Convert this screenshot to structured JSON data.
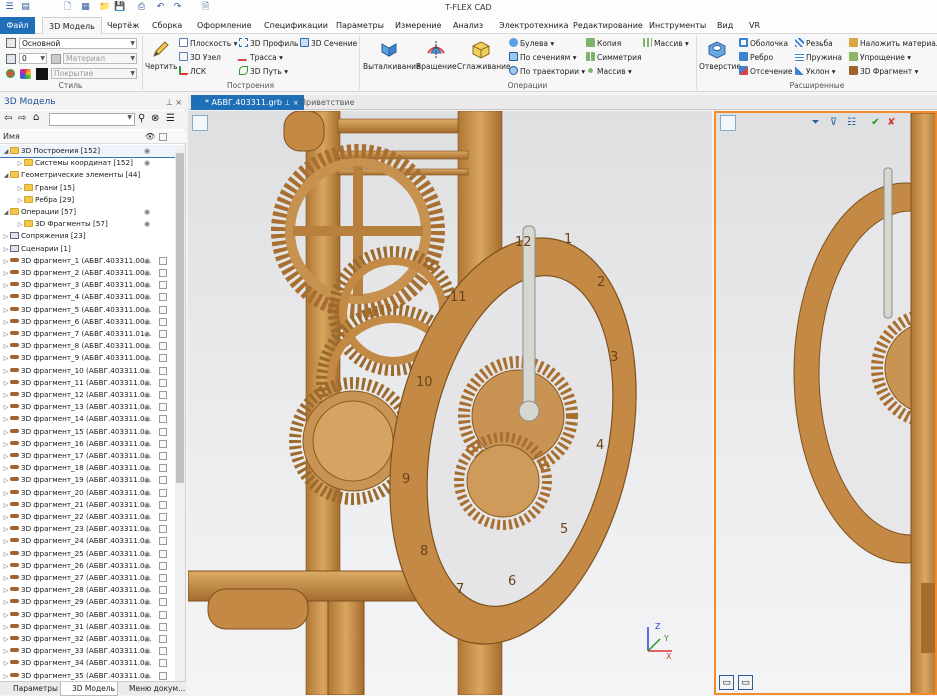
{
  "app": {
    "title": "T-FLEX CAD"
  },
  "menu": {
    "file": "Файл",
    "tabs": [
      "3D Модель",
      "Чертёж",
      "Сборка",
      "Оформление",
      "Спецификации",
      "Параметры",
      "Измерение",
      "Анализ",
      "Электротехника",
      "Редактирование",
      "Инструменты",
      "Вид",
      "VR"
    ],
    "active_index": 0
  },
  "ribbon": {
    "style": {
      "label": "Стиль",
      "layer_value": "Основной",
      "level_value": "0",
      "material_placeholder": "Материал",
      "coating_placeholder": "Покрытие"
    },
    "construct": {
      "label": "Построения",
      "draw": "Чертить",
      "plane": "Плоскость",
      "node3d": "3D Узел",
      "lcs": "ЛСК",
      "profile3d": "3D Профиль",
      "route": "Трасса",
      "path3d": "3D Путь",
      "section3d": "3D Сечение"
    },
    "operations": {
      "label": "Операции",
      "extrude": "Выталкивание",
      "rotate": "Вращение",
      "smooth": "Сглаживание",
      "boolean": "Булева",
      "by_sections": "По сечениям",
      "by_path": "По траектории",
      "copy": "Копия",
      "symmetry": "Симметрия",
      "array": "Массив",
      "array2": "Массив"
    },
    "extended": {
      "label": "Расширенные",
      "hole": "Отверстие",
      "shell": "Оболочка",
      "rib": "Ребро",
      "cutoff": "Отсечение",
      "thread": "Резьба",
      "spring": "Пружина",
      "slope": "Уклон",
      "apply_material": "Наложить материал",
      "simplify": "Упрощение",
      "fragment3d": "3D Фрагмент"
    }
  },
  "panel": {
    "title": "3D Модель",
    "column_name": "Имя",
    "tree": [
      {
        "label": "3D Построения [152]",
        "level": 0,
        "kind": "folder",
        "exp": "open",
        "eye": true,
        "selected": true
      },
      {
        "label": "Системы координат [152]",
        "level": 1,
        "kind": "folder",
        "exp": "closed",
        "eye": true
      },
      {
        "label": "Геометрические элементы [44]",
        "level": 0,
        "kind": "folder",
        "exp": "open"
      },
      {
        "label": "Грани [15]",
        "level": 1,
        "kind": "folder",
        "exp": "closed"
      },
      {
        "label": "Ребра [29]",
        "level": 1,
        "kind": "folder",
        "exp": "closed"
      },
      {
        "label": "Операции [57]",
        "level": 0,
        "kind": "folder",
        "exp": "open",
        "eye": true
      },
      {
        "label": "3D Фрагменты [57]",
        "level": 1,
        "kind": "folder",
        "exp": "closed",
        "eye": true
      },
      {
        "label": "Сопряжения [23]",
        "level": 0,
        "kind": "node",
        "exp": "closed"
      },
      {
        "label": "Сценарии [1]",
        "level": 0,
        "kind": "node",
        "exp": "closed"
      },
      {
        "label": "3D фрагмент_1 (АБВГ.403311.00...",
        "level": 0,
        "kind": "frag",
        "exp": "closed",
        "eye": true,
        "copy": true
      },
      {
        "label": "3D фрагмент_2 (АБВГ.403311.00...",
        "level": 0,
        "kind": "frag",
        "exp": "closed",
        "eye": true,
        "copy": true
      },
      {
        "label": "3D фрагмент_3 (АБВГ.403311.00...",
        "level": 0,
        "kind": "frag",
        "exp": "closed",
        "eye": true,
        "copy": true
      },
      {
        "label": "3D фрагмент_4 (АБВГ.403311.00...",
        "level": 0,
        "kind": "frag",
        "exp": "closed",
        "eye": true,
        "copy": true
      },
      {
        "label": "3D фрагмент_5 (АБВГ.403311.00...",
        "level": 0,
        "kind": "frag",
        "exp": "closed",
        "eye": true,
        "copy": true
      },
      {
        "label": "3D фрагмент_6 (АБВГ.403311.00...",
        "level": 0,
        "kind": "frag",
        "exp": "closed",
        "eye": true,
        "copy": true
      },
      {
        "label": "3D фрагмент_7 (АБВГ.403311.01...",
        "level": 0,
        "kind": "frag",
        "exp": "closed",
        "eye": true,
        "copy": true
      },
      {
        "label": "3D фрагмент_8 (АБВГ.403311.00...",
        "level": 0,
        "kind": "frag",
        "exp": "closed",
        "eye": true,
        "copy": true
      },
      {
        "label": "3D фрагмент_9 (АБВГ.403311.00...",
        "level": 0,
        "kind": "frag",
        "exp": "closed",
        "eye": true,
        "copy": true
      },
      {
        "label": "3D фрагмент_10 (АБВГ.403311.0...",
        "level": 0,
        "kind": "frag",
        "exp": "closed",
        "eye": true,
        "copy": true
      },
      {
        "label": "3D фрагмент_11 (АБВГ.403311.0...",
        "level": 0,
        "kind": "frag",
        "exp": "closed",
        "eye": true,
        "copy": true
      },
      {
        "label": "3D фрагмент_12 (АБВГ.403311.0...",
        "level": 0,
        "kind": "frag",
        "exp": "closed",
        "eye": true,
        "copy": true
      },
      {
        "label": "3D фрагмент_13 (АБВГ.403311.0...",
        "level": 0,
        "kind": "frag",
        "exp": "closed",
        "eye": true,
        "copy": true
      },
      {
        "label": "3D фрагмент_14 (АБВГ.403311.0...",
        "level": 0,
        "kind": "frag",
        "exp": "closed",
        "eye": true,
        "copy": true
      },
      {
        "label": "3D фрагмент_15 (АБВГ.403311.0...",
        "level": 0,
        "kind": "frag",
        "exp": "closed",
        "eye": true,
        "copy": true
      },
      {
        "label": "3D фрагмент_16 (АБВГ.403311.0...",
        "level": 0,
        "kind": "frag",
        "exp": "closed",
        "eye": true,
        "copy": true
      },
      {
        "label": "3D фрагмент_17 (АБВГ.403311.0...",
        "level": 0,
        "kind": "frag",
        "exp": "closed",
        "eye": true,
        "copy": true
      },
      {
        "label": "3D фрагмент_18 (АБВГ.403311.0...",
        "level": 0,
        "kind": "frag",
        "exp": "closed",
        "eye": true,
        "copy": true
      },
      {
        "label": "3D фрагмент_19 (АБВГ.403311.0...",
        "level": 0,
        "kind": "frag",
        "exp": "closed",
        "eye": true,
        "copy": true
      },
      {
        "label": "3D фрагмент_20 (АБВГ.403311.0...",
        "level": 0,
        "kind": "frag",
        "exp": "closed",
        "eye": true,
        "copy": true
      },
      {
        "label": "3D фрагмент_21 (АБВГ.403311.0...",
        "level": 0,
        "kind": "frag",
        "exp": "closed",
        "eye": true,
        "copy": true
      },
      {
        "label": "3D фрагмент_22 (АБВГ.403311.0...",
        "level": 0,
        "kind": "frag",
        "exp": "closed",
        "eye": true,
        "copy": true
      },
      {
        "label": "3D фрагмент_23 (АБВГ.403311.0...",
        "level": 0,
        "kind": "frag",
        "exp": "closed",
        "eye": true,
        "copy": true
      },
      {
        "label": "3D фрагмент_24 (АБВГ.403311.0...",
        "level": 0,
        "kind": "frag",
        "exp": "closed",
        "eye": true,
        "copy": true
      },
      {
        "label": "3D фрагмент_25 (АБВГ.403311.0...",
        "level": 0,
        "kind": "frag",
        "exp": "closed",
        "eye": true,
        "copy": true
      },
      {
        "label": "3D фрагмент_26 (АБВГ.403311.0...",
        "level": 0,
        "kind": "frag",
        "exp": "closed",
        "eye": true,
        "copy": true
      },
      {
        "label": "3D фрагмент_27 (АБВГ.403311.0...",
        "level": 0,
        "kind": "frag",
        "exp": "closed",
        "eye": true,
        "copy": true
      },
      {
        "label": "3D фрагмент_28 (АБВГ.403311.0...",
        "level": 0,
        "kind": "frag",
        "exp": "closed",
        "eye": true,
        "copy": true
      },
      {
        "label": "3D фрагмент_29 (АБВГ.403311.0...",
        "level": 0,
        "kind": "frag",
        "exp": "closed",
        "eye": true,
        "copy": true
      },
      {
        "label": "3D фрагмент_30 (АБВГ.403311.0...",
        "level": 0,
        "kind": "frag",
        "exp": "closed",
        "eye": true,
        "copy": true
      },
      {
        "label": "3D фрагмент_31 (АБВГ.403311.0...",
        "level": 0,
        "kind": "frag",
        "exp": "closed",
        "eye": true,
        "copy": true
      },
      {
        "label": "3D фрагмент_32 (АБВГ.403311.0...",
        "level": 0,
        "kind": "frag",
        "exp": "closed",
        "eye": true,
        "copy": true
      },
      {
        "label": "3D фрагмент_33 (АБВГ.403311.0...",
        "level": 0,
        "kind": "frag",
        "exp": "closed",
        "eye": true,
        "copy": true
      },
      {
        "label": "3D фрагмент_34 (АБВГ.403311.0...",
        "level": 0,
        "kind": "frag",
        "exp": "closed",
        "eye": true,
        "copy": true
      },
      {
        "label": "3D фрагмент_35 (АБВГ.403311.0...",
        "level": 0,
        "kind": "frag",
        "exp": "closed",
        "eye": true,
        "copy": true
      }
    ]
  },
  "bottom_tabs": [
    "Параметры",
    "3D Модель",
    "Меню докум..."
  ],
  "bottom_active_index": 1,
  "doc_tabs": [
    {
      "label": "* АБВГ.403311.grb",
      "active": true
    },
    {
      "label": "Приветствие",
      "active": false
    }
  ],
  "viewport": {
    "dial_numbers": [
      "12",
      "1",
      "2",
      "3",
      "4",
      "5",
      "6",
      "7",
      "8",
      "9",
      "10",
      "11"
    ],
    "axis": {
      "x": "X",
      "y": "Y",
      "z": "Z"
    }
  },
  "colors": {
    "accent": "#1f6fb8",
    "wood": "#c9914a",
    "wood_dark": "#9c6a2c",
    "active_view_border": "#f28c2b"
  }
}
